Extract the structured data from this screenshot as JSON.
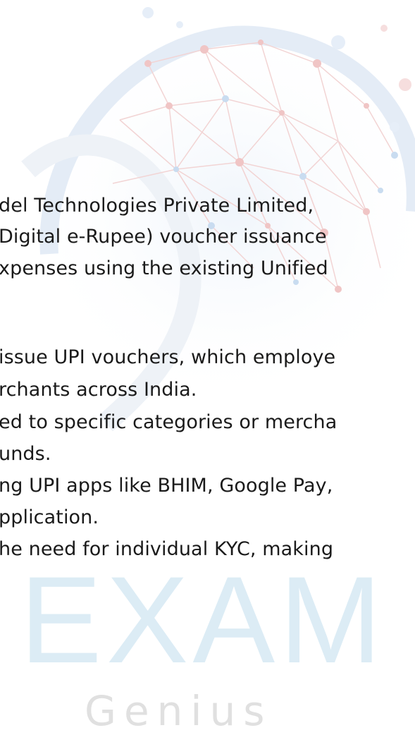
{
  "document": {
    "lines": [
      "del Technologies Private Limited,",
      "Digital e-Rupee) voucher issuance",
      "xpenses using the existing Unified",
      "issue UPI vouchers, which employe",
      "rchants across India.",
      "ed to specific categories or mercha",
      "unds.",
      "ng UPI apps like BHIM, Google Pay,",
      "pplication.",
      "he need for individual KYC, making"
    ]
  },
  "watermark": {
    "line1": "EXAM",
    "line2": "Genius"
  },
  "colors": {
    "text": "#1a1a1a",
    "watermark_blue": "#dcecf5",
    "watermark_grey": "#e0e0e0",
    "network_red": "#f3b7b7",
    "network_blue": "#bcd4ee"
  }
}
